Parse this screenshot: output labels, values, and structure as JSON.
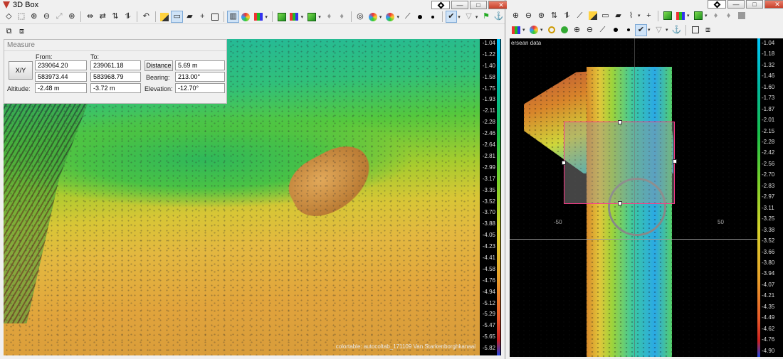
{
  "left_window": {
    "title": "3D Box",
    "measure": {
      "panel_title": "Measure",
      "from_label": "From:",
      "to_label": "To:",
      "xy_button": "X/Y",
      "from_x": "239064.20",
      "from_y": "583973.44",
      "to_x": "239061.18",
      "to_y": "583968.79",
      "altitude_label": "Altitude:",
      "from_altitude": "-2.48 m",
      "to_altitude": "-3.72 m",
      "distance_button": "Distance",
      "distance_value": "5.69 m",
      "bearing_label": "Bearing:",
      "bearing_value": "213.00°",
      "elevation_label": "Elevation:",
      "elevation_value": "-12.70°"
    },
    "scale_ticks": [
      "-1.04",
      "-1.22",
      "-1.40",
      "-1.58",
      "-1.75",
      "-1.93",
      "-2.11",
      "-2.28",
      "-2.46",
      "-2.64",
      "-2.81",
      "-2.99",
      "-3.17",
      "-3.35",
      "-3.52",
      "-3.70",
      "-3.88",
      "-4.05",
      "-4.23",
      "-4.41",
      "-4.58",
      "-4.76",
      "-4.94",
      "-5.12",
      "-5.29",
      "-5.47",
      "-5.65",
      "-5.82"
    ],
    "footnote": "colortable: autocoltab_171109 Van Starkenborghkanaal"
  },
  "right_window": {
    "viewport_label": "ersean data",
    "axis_left": "-50",
    "axis_right": "50",
    "scale_ticks": [
      "-1.04",
      "-1.18",
      "-1.32",
      "-1.46",
      "-1.60",
      "-1.73",
      "-1.87",
      "-2.01",
      "-2.15",
      "-2.28",
      "-2.42",
      "-2.56",
      "-2.70",
      "-2.83",
      "-2.97",
      "-3.11",
      "-3.25",
      "-3.38",
      "-3.52",
      "-3.66",
      "-3.80",
      "-3.94",
      "-4.07",
      "-4.21",
      "-4.35",
      "-4.49",
      "-4.62",
      "-4.76",
      "-4.90"
    ]
  },
  "colors": {
    "selection_border": "#ff3a8a",
    "background_black": "#000000"
  }
}
